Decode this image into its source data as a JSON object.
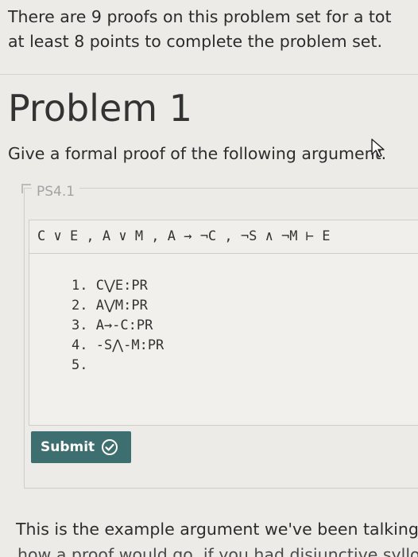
{
  "intro": {
    "line1": "There are 9 proofs on this problem set for a tot",
    "line2": "at least 8 points to complete the problem set."
  },
  "problem": {
    "title": "Problem 1",
    "prompt": "Give a formal proof of the following argument."
  },
  "problem_set": {
    "label": "PS4.1",
    "argument": "C ∨ E , A ∨ M , A → ¬C , ¬S ∧ ¬M ⊢ E",
    "proof_lines": [
      "1. C⋁E:PR",
      "2. A⋁M:PR",
      "3. A→-C:PR",
      "4. -S⋀-M:PR",
      "5."
    ],
    "submit_label": "Submit"
  },
  "footer": {
    "line1": "This is the example argument we've been talking",
    "line2_partial": "how a proof would go, if you had disjunctive syllo"
  },
  "colors": {
    "submit_bg": "#3e6f70",
    "page_bg": "#ecebe8"
  },
  "icons": [
    "mouse-pointer-icon",
    "check-circle-icon"
  ]
}
